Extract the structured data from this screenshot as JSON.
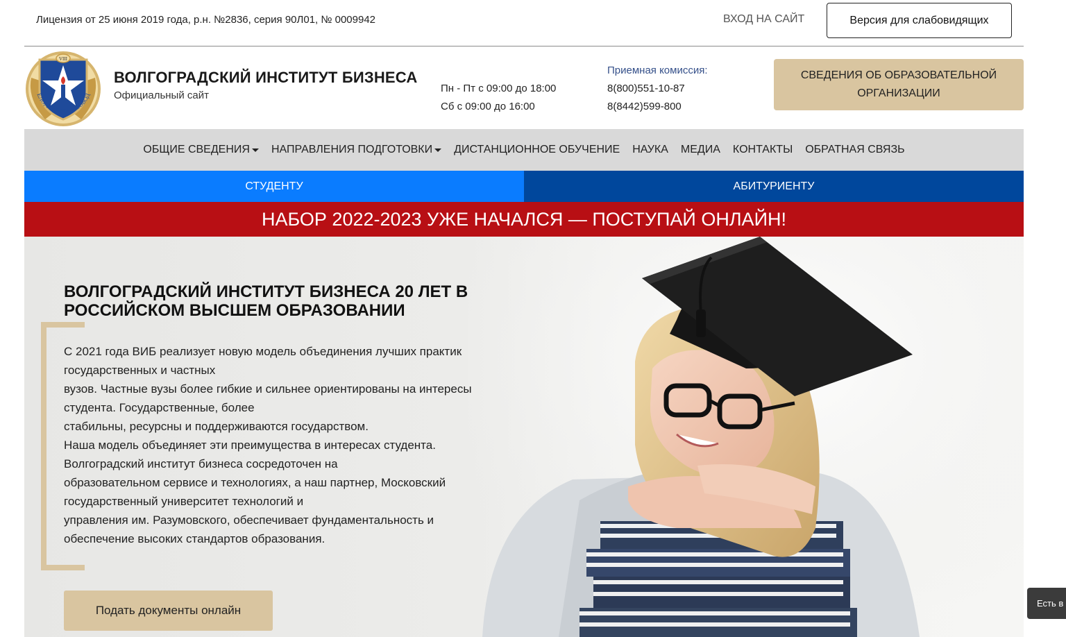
{
  "topbar": {
    "license": "Лицензия от 25 июня 2019 года, р.н. №2836, серия 90Л01, № 0009942",
    "login": "ВХОД НА САЙТ",
    "vision_version": "Версия для слабовидящих"
  },
  "header": {
    "title": "ВОЛГОГРАДСКИЙ ИНСТИТУТ БИЗНЕСА",
    "subtitle": "Официальный сайт",
    "logo": {
      "motto": "ДЕЛО, РОДИНА, СВОБОДА",
      "roman": "VIII"
    },
    "hours": [
      "Пн - Пт с 09:00 до 18:00",
      "Сб с 09:00 до 16:00"
    ],
    "admissions_label": "Приемная комиссия:",
    "phones": [
      "8(800)551-10-87",
      "8(8442)599-800"
    ],
    "info_button": "СВЕДЕНИЯ ОБ ОБРАЗОВАТЕЛЬНОЙ ОРГАНИЗАЦИИ"
  },
  "nav": {
    "items": [
      {
        "label": "ОБЩИЕ СВЕДЕНИЯ",
        "dropdown": true
      },
      {
        "label": "НАПРАВЛЕНИЯ ПОДГОТОВКИ",
        "dropdown": true
      },
      {
        "label": "ДИСТАНЦИОННОЕ ОБУЧЕНИЕ",
        "dropdown": false
      },
      {
        "label": "НАУКА",
        "dropdown": false
      },
      {
        "label": "МЕДИА",
        "dropdown": false
      },
      {
        "label": "КОНТАКТЫ",
        "dropdown": false
      },
      {
        "label": "ОБРАТНАЯ СВЯЗЬ",
        "dropdown": false
      }
    ]
  },
  "roles": {
    "student": "СТУДЕНТУ",
    "applicant": "АБИТУРИЕНТУ"
  },
  "banner": {
    "text": "НАБОР 2022-2023 УЖЕ НАЧАЛСЯ — ПОСТУПАЙ ОНЛАЙН!"
  },
  "hero": {
    "title": "ВОЛГОГРАДСКИЙ ИНСТИТУТ БИЗНЕСА 20 ЛЕТ В РОССИЙСКОМ ВЫСШЕМ ОБРАЗОВАНИИ",
    "lines": [
      "С 2021 года ВИБ реализует новую модель объединения лучших практик",
      "государственных и частных",
      "вузов. Частные вузы более гибкие и сильнее ориентированы на интересы",
      "студента. Государственные, более",
      "стабильны, ресурсны и поддерживаются государством.",
      "Наша модель объединяет эти преимущества в интересах студента.",
      "Волгоградский институт бизнеса сосредоточен на",
      "образовательном сервисе и технологиях, а наш партнер, Московский",
      "государственный университет технологий и",
      "управления им. Разумовского, обеспечивает фундаментальность и",
      "обеспечение высоких стандартов образования."
    ],
    "apply_button": "Подать документы онлайн"
  },
  "chat": {
    "label": "Есть в"
  },
  "colors": {
    "gold": "#d9c5a0",
    "student_blue": "#0a7cff",
    "applicant_blue": "#00479c",
    "banner_red": "#b80f14",
    "nav_gray": "#d9d9d9"
  }
}
